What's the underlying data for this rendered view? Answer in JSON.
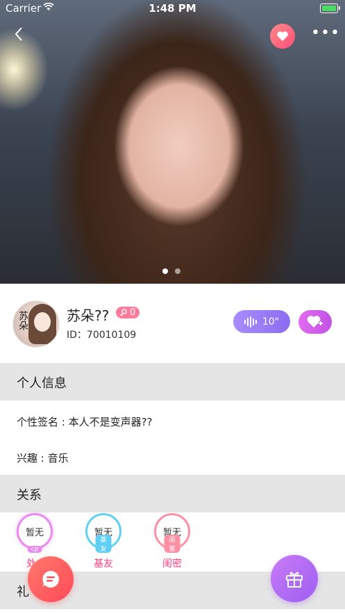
{
  "status_bar": {
    "carrier": "Carrier",
    "time": "1:48 PM"
  },
  "gallery": {
    "page_count": 2,
    "active_index": 0
  },
  "profile": {
    "avatar_text": "苏朵",
    "name": "苏朵??",
    "pill_count": "0",
    "id_text": "ID：70010109",
    "voice_duration": "10\""
  },
  "sections": {
    "personal_info": "个人信息",
    "relations": "关系",
    "gifts": "礼"
  },
  "personal": {
    "signature": "个性签名 : 本人不是变声器??",
    "interest": "兴趣 : 音乐"
  },
  "relations": [
    {
      "badge": "暂无",
      "ribbon": "cp",
      "label": "处C"
    },
    {
      "badge": "暂无",
      "ribbon": "基友",
      "label": "基友"
    },
    {
      "badge": "暂无",
      "ribbon": "闺蜜",
      "label": "闺密"
    }
  ],
  "colors": {
    "accent_pink": "#ff3d7f",
    "voice_purple": "#8b6cf0",
    "like_magenta": "#c252e6",
    "section_gray": "#e5e5e5"
  }
}
